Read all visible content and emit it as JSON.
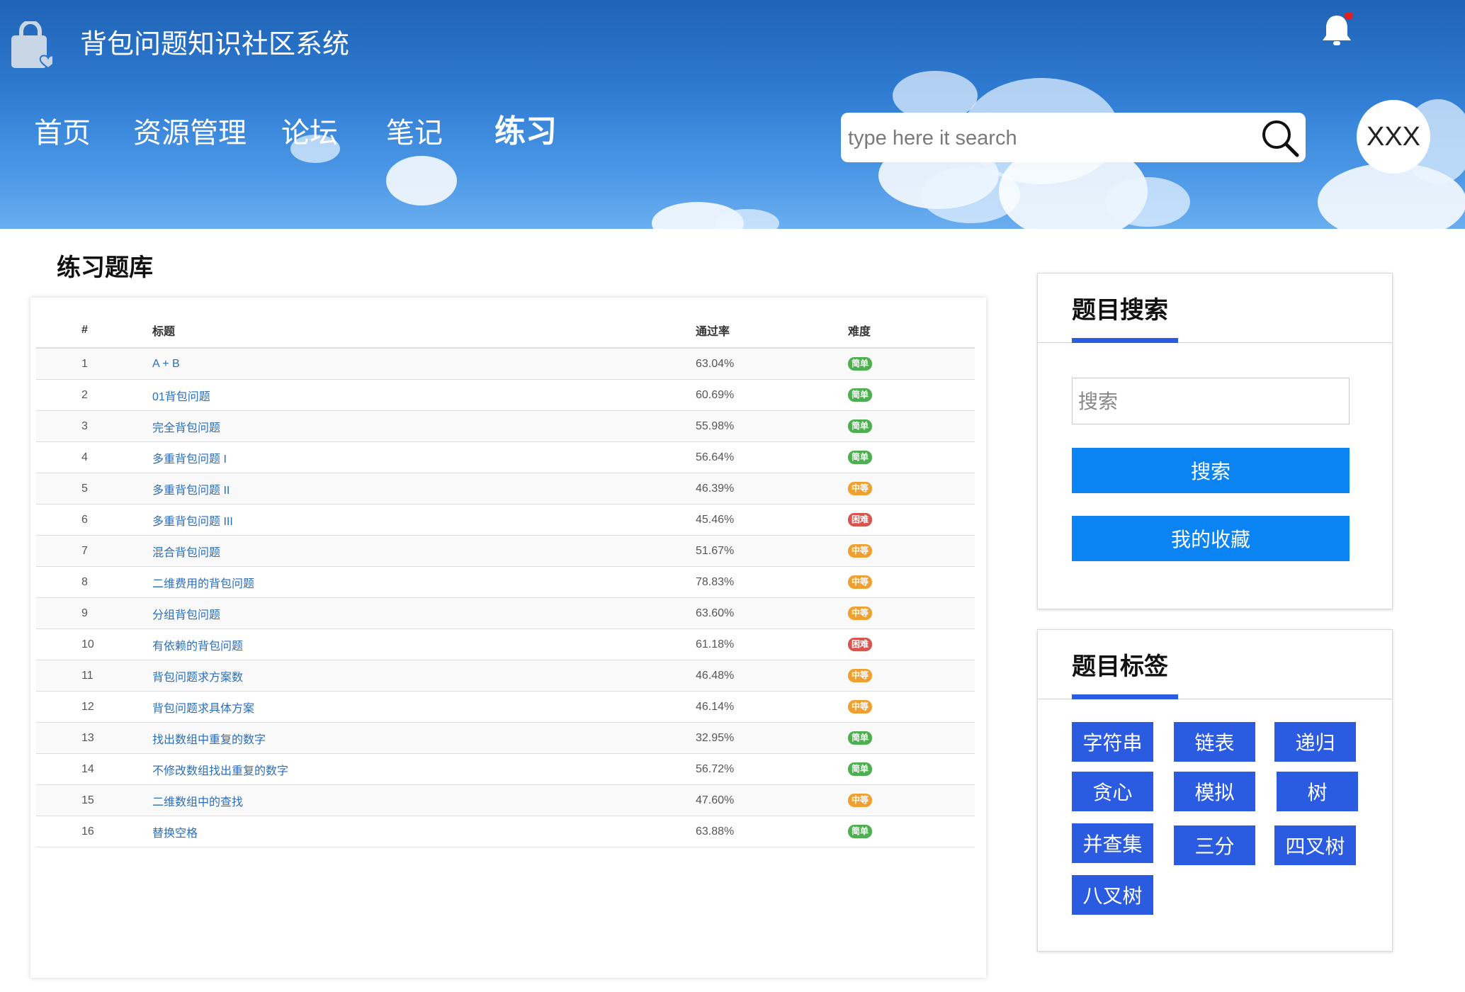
{
  "header": {
    "site_title": "背包问题知识社区系统",
    "nav": [
      "首页",
      "资源管理",
      "论坛",
      "笔记",
      "练习"
    ],
    "active_nav": "练习",
    "search_placeholder": "type here it search",
    "avatar_text": "XXX",
    "notification_dot": true
  },
  "main": {
    "page_title": "练习题库",
    "columns": [
      "#",
      "标题",
      "通过率",
      "难度"
    ],
    "rows": [
      {
        "num": "1",
        "title": "A + B",
        "rate": "63.04%",
        "difficulty": "简单"
      },
      {
        "num": "2",
        "title": "01背包问题",
        "rate": "60.69%",
        "difficulty": "简单"
      },
      {
        "num": "3",
        "title": "完全背包问题",
        "rate": "55.98%",
        "difficulty": "简单"
      },
      {
        "num": "4",
        "title": "多重背包问题 I",
        "rate": "56.64%",
        "difficulty": "简单"
      },
      {
        "num": "5",
        "title": "多重背包问题 II",
        "rate": "46.39%",
        "difficulty": "中等"
      },
      {
        "num": "6",
        "title": "多重背包问题 III",
        "rate": "45.46%",
        "difficulty": "困难"
      },
      {
        "num": "7",
        "title": "混合背包问题",
        "rate": "51.67%",
        "difficulty": "中等"
      },
      {
        "num": "8",
        "title": "二维费用的背包问题",
        "rate": "78.83%",
        "difficulty": "中等"
      },
      {
        "num": "9",
        "title": "分组背包问题",
        "rate": "63.60%",
        "difficulty": "中等"
      },
      {
        "num": "10",
        "title": "有依赖的背包问题",
        "rate": "61.18%",
        "difficulty": "困难"
      },
      {
        "num": "11",
        "title": "背包问题求方案数",
        "rate": "46.48%",
        "difficulty": "中等"
      },
      {
        "num": "12",
        "title": "背包问题求具体方案",
        "rate": "46.14%",
        "difficulty": "中等"
      },
      {
        "num": "13",
        "title": "找出数组中重复的数字",
        "rate": "32.95%",
        "difficulty": "简单"
      },
      {
        "num": "14",
        "title": "不修改数组找出重复的数字",
        "rate": "56.72%",
        "difficulty": "简单"
      },
      {
        "num": "15",
        "title": "二维数组中的查找",
        "rate": "47.60%",
        "difficulty": "中等"
      },
      {
        "num": "16",
        "title": "替换空格",
        "rate": "63.88%",
        "difficulty": "简单"
      }
    ]
  },
  "sidebar": {
    "search_panel": {
      "title": "题目搜索",
      "input_placeholder": "搜索",
      "search_button": "搜索",
      "favorites_button": "我的收藏"
    },
    "tags_panel": {
      "title": "题目标签",
      "tags": [
        "字符串",
        "链表",
        "递归",
        "贪心",
        "模拟",
        "树",
        "并查集",
        "三分",
        "四叉树",
        "八叉树"
      ]
    }
  },
  "colors": {
    "easy": "#4caf50",
    "medium": "#f0a030",
    "hard": "#d9534f",
    "primary_button": "#0a84f3",
    "tag": "#2a5be0",
    "link": "#2a6eb8"
  }
}
